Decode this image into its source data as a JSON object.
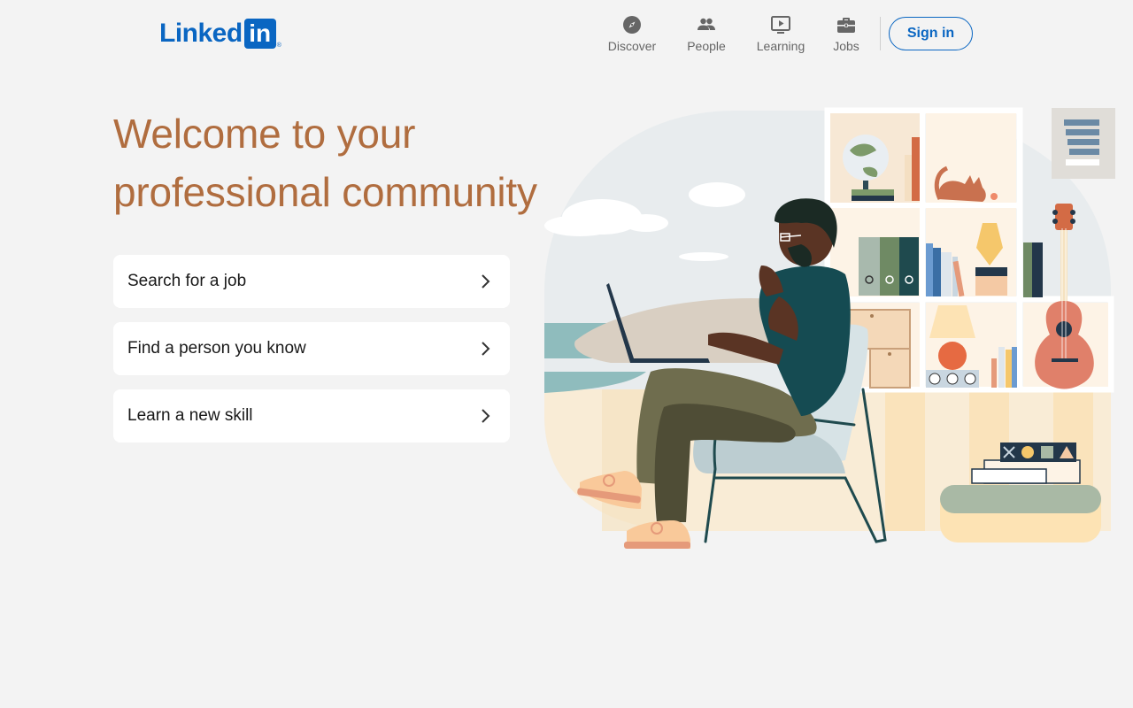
{
  "brand": {
    "word": "Linked",
    "box": "in",
    "reg": "®"
  },
  "nav": {
    "items": [
      {
        "label": "Discover",
        "icon": "compass-icon"
      },
      {
        "label": "People",
        "icon": "people-icon"
      },
      {
        "label": "Learning",
        "icon": "video-play-icon"
      },
      {
        "label": "Jobs",
        "icon": "briefcase-icon"
      }
    ],
    "signin_label": "Sign in"
  },
  "hero": {
    "title_line1": "Welcome to your",
    "title_line2": "professional community"
  },
  "options": [
    {
      "label": "Search for a job",
      "icon": "chevron-right-icon"
    },
    {
      "label": "Find a person you know",
      "icon": "chevron-right-icon"
    },
    {
      "label": "Learn a new skill",
      "icon": "chevron-right-icon"
    }
  ],
  "colors": {
    "brand_blue": "#0a66c2",
    "hero_text": "#b06d3f",
    "background": "#f3f3f3"
  }
}
